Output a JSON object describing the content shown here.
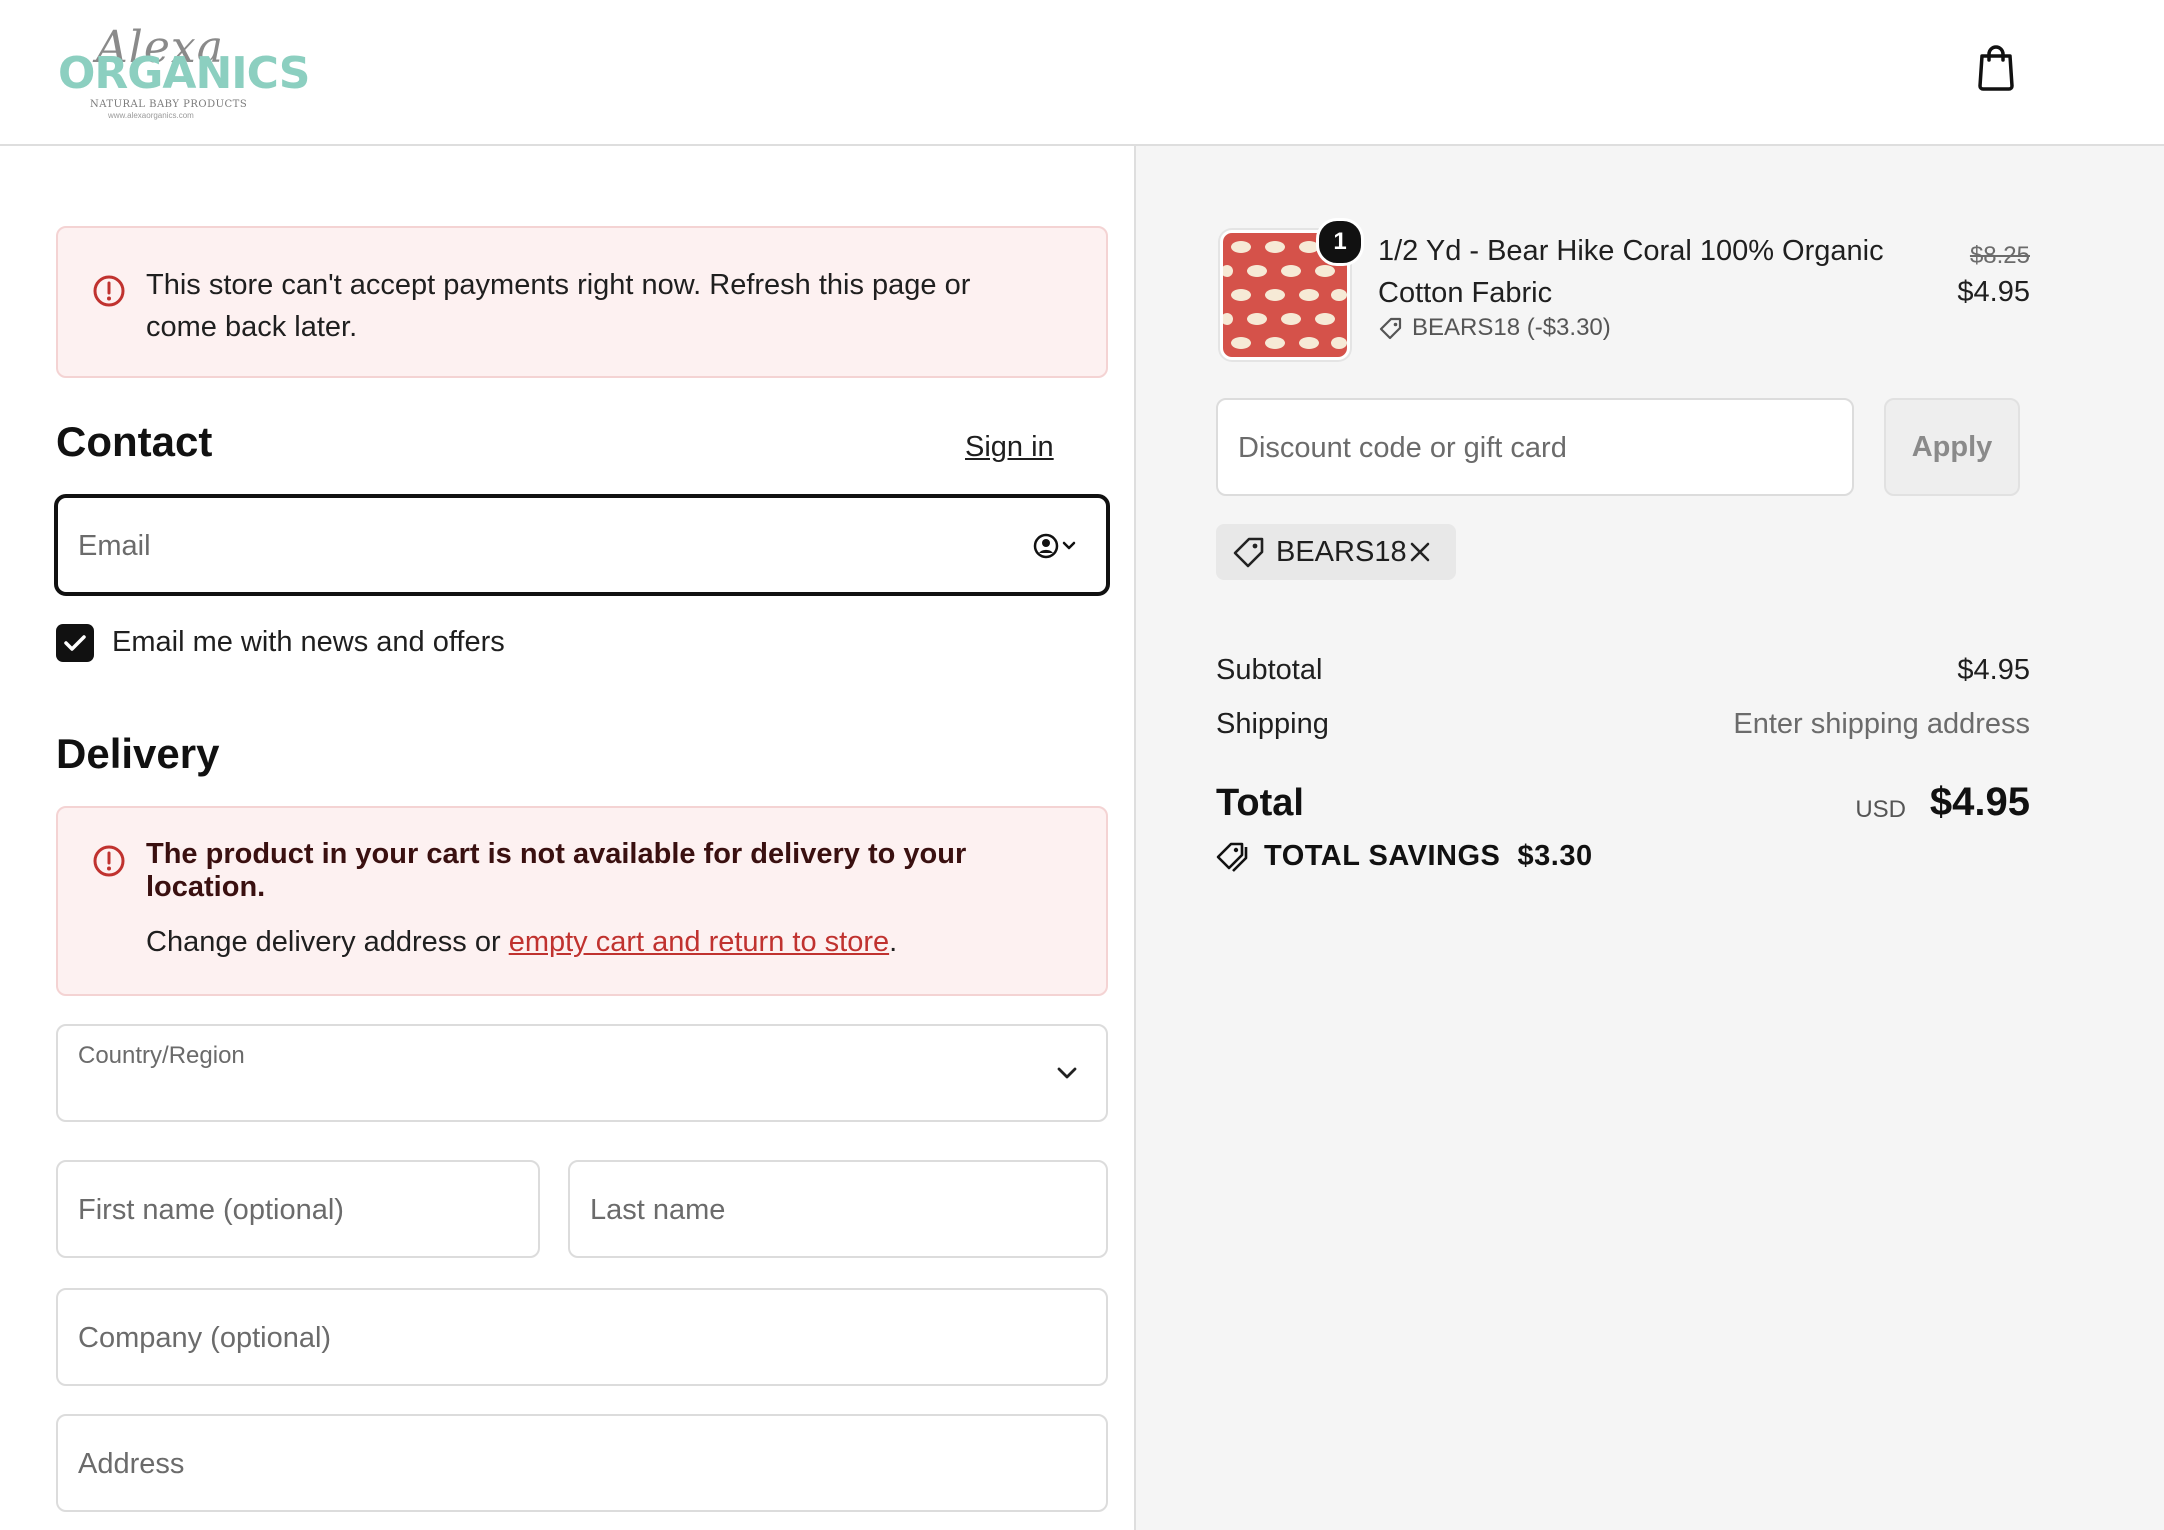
{
  "header": {
    "logo_script": "Alexa",
    "logo_brand": "ORGANICS",
    "logo_tagline": "NATURAL BABY PRODUCTS",
    "logo_url": "www.alexaorganics.com"
  },
  "alerts": {
    "payments": "This store can't accept payments right now. Refresh this page or come back later.",
    "delivery_title": "The product in your cart is not available for delivery to your location.",
    "delivery_body_prefix": "Change delivery address or ",
    "delivery_body_link": "empty cart and return to store",
    "delivery_body_suffix": "."
  },
  "contact": {
    "heading": "Contact",
    "sign_in": "Sign in",
    "email_placeholder": "Email",
    "newsletter_label": "Email me with news and offers",
    "newsletter_checked": true
  },
  "delivery": {
    "heading": "Delivery",
    "country_label": "Country/Region",
    "first_name_placeholder": "First name (optional)",
    "last_name_placeholder": "Last name",
    "company_placeholder": "Company (optional)",
    "address_placeholder": "Address"
  },
  "cart": {
    "item": {
      "quantity": "1",
      "name": "1/2 Yd - Bear Hike Coral 100% Organic Cotton Fabric",
      "discount": "BEARS18 (-$3.30)",
      "original_price": "$8.25",
      "price": "$4.95",
      "thumb_color": "#d5524a"
    },
    "discount_placeholder": "Discount code or gift card",
    "apply_label": "Apply",
    "applied_code": "BEARS18",
    "subtotal_label": "Subtotal",
    "subtotal_value": "$4.95",
    "shipping_label": "Shipping",
    "shipping_value": "Enter shipping address",
    "total_label": "Total",
    "currency": "USD",
    "total_value": "$4.95",
    "savings_label": "TOTAL SAVINGS",
    "savings_value": "$3.30"
  },
  "colors": {
    "alert_bg": "#fdf1f1",
    "link_red": "#c0322f",
    "brand_teal": "#8ccfc0"
  }
}
